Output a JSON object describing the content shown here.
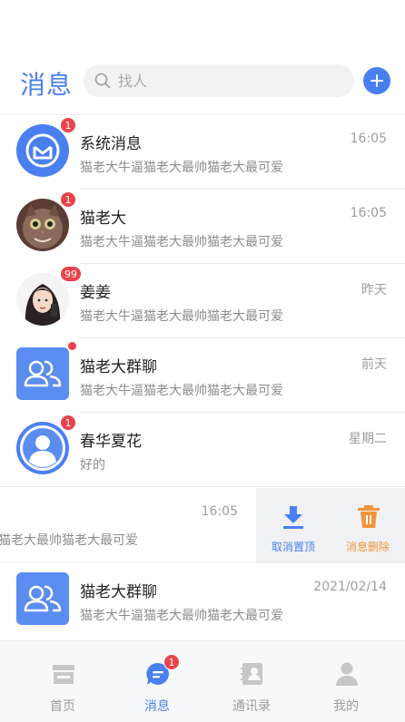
{
  "header": {
    "title": "消息",
    "search_placeholder": "找人"
  },
  "conversations": [
    {
      "name": "系统消息",
      "time": "16:05",
      "preview": "猫老大牛逼猫老大最帅猫老大最可爱",
      "badge": "1",
      "avatar": "system-mail-icon"
    },
    {
      "name": "猫老大",
      "time": "16:05",
      "preview": "猫老大牛逼猫老大最帅猫老大最可爱",
      "badge": "1",
      "avatar": "cat-photo"
    },
    {
      "name": "姜姜",
      "time": "昨天",
      "preview": "猫老大牛逼猫老大最帅猫老大最可爱",
      "badge": "99",
      "avatar": "girl-photo"
    },
    {
      "name": "猫老大群聊",
      "time": "前天",
      "preview": "猫老大牛逼猫老大最帅猫老大最可爱",
      "badge": "",
      "avatar": "group-icon"
    },
    {
      "name": "春华夏花",
      "time": "星期二",
      "preview": "好的",
      "badge": "1",
      "avatar": "user-icon"
    }
  ],
  "swiped_row": {
    "time": "16:05",
    "preview": "猫老大最帅猫老大最可爱",
    "actions": [
      {
        "label": "取消置顶",
        "color": "#4a7ff0"
      },
      {
        "label": "消息删除",
        "color": "#f4943c"
      }
    ]
  },
  "last_row": {
    "name": "猫老大群聊",
    "time": "2021/02/14",
    "preview": "猫老大牛逼猫老大最帅猫老大最可爱"
  },
  "tabs": [
    {
      "label": "首页"
    },
    {
      "label": "消息",
      "badge": "1"
    },
    {
      "label": "通讯录"
    },
    {
      "label": "我的"
    }
  ],
  "colors": {
    "accent": "#4a7ff0",
    "badge": "#e8434a",
    "delete": "#f4943c"
  }
}
